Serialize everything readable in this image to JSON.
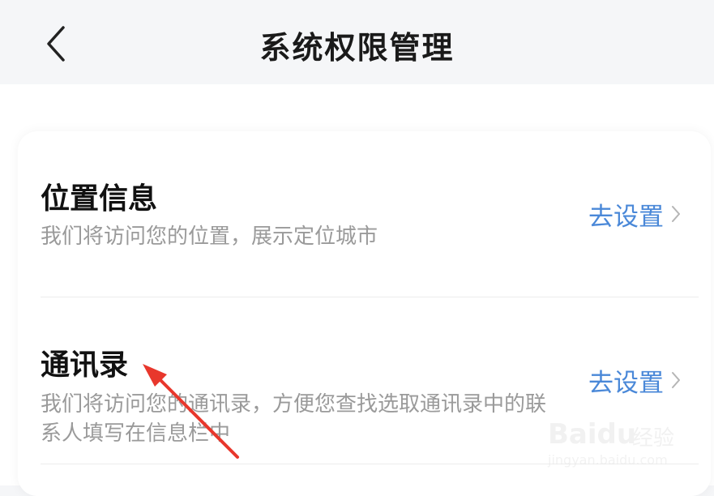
{
  "header": {
    "title": "系统权限管理",
    "back_icon": "chevron-left-icon"
  },
  "permissions": [
    {
      "title": "位置信息",
      "description": "我们将访问您的位置，展示定位城市",
      "action_label": "去设置"
    },
    {
      "title": "通讯录",
      "description": "我们将访问您的通讯录，方便您查找选取通讯录中的联系人填写在信息栏中",
      "action_label": "去设置"
    }
  ],
  "annotation": {
    "arrow_color": "#e8372c"
  },
  "watermark": {
    "brand": "Baidu",
    "product": "经验",
    "url": "jingyan.baidu.com"
  },
  "colors": {
    "accent": "#4a88d8",
    "title_text": "#111111",
    "secondary_text": "#9a9a9a",
    "header_bg": "#f5f6f8"
  }
}
